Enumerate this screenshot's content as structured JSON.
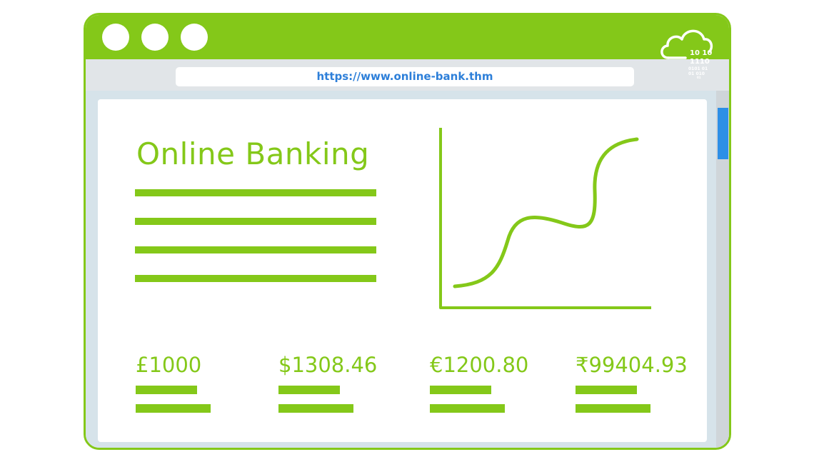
{
  "browser": {
    "url": "https://www.online-bank.thm",
    "window_buttons": [
      "window-dot",
      "window-dot",
      "window-dot"
    ],
    "cloud_icon": "cloud-binary-icon",
    "binary_text": [
      "10 10",
      "1110",
      "0101 01",
      "01 010",
      "01"
    ]
  },
  "page": {
    "title": "Online Banking",
    "accounts": [
      {
        "amount": "£1000"
      },
      {
        "amount": "$1308.46"
      },
      {
        "amount": "€1200.80"
      },
      {
        "amount": "₹99404.93"
      }
    ]
  },
  "colors": {
    "brand_green": "#84c819",
    "link_blue": "#2d7fd9",
    "scroll_thumb": "#2d8fe6"
  }
}
